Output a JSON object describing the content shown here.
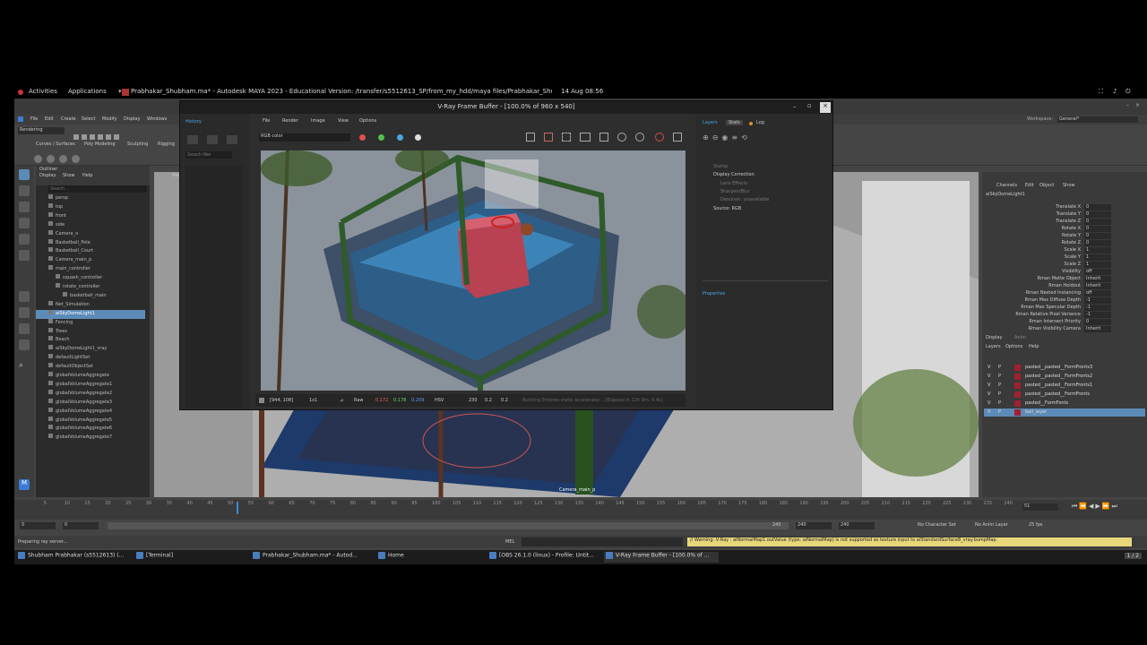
{
  "topbar": {
    "activities": "Activities",
    "applications": "Applications",
    "window_title": "Prabhakar_Shubham.ma* - Autodesk MAYA 2023 - Educational Version: /transfer/s5512613_SP/from_my_hdd/maya files/Prabhakar_Shu...",
    "clock": "14 Aug 08:56"
  },
  "maya": {
    "menu": [
      "File",
      "Edit",
      "Create",
      "Select",
      "Modify",
      "Display",
      "Windows"
    ],
    "mode": "Rendering",
    "shelf_tabs": [
      "Curves / Surfaces",
      "Poly Modeling",
      "Sculpting",
      "Rigging"
    ],
    "workspace_label": "Workspace:",
    "workspace_value": "General*",
    "outliner": {
      "title": "Outliner",
      "menu": [
        "Display",
        "Show",
        "Help"
      ],
      "search_placeholder": "Search...",
      "items": [
        {
          "label": "persp",
          "selected": false,
          "indent": 1
        },
        {
          "label": "top",
          "selected": false,
          "indent": 1
        },
        {
          "label": "front",
          "selected": false,
          "indent": 1
        },
        {
          "label": "side",
          "selected": false,
          "indent": 1
        },
        {
          "label": "Camera_o",
          "selected": false,
          "indent": 1
        },
        {
          "label": "Basketball_Pole",
          "selected": false,
          "indent": 1
        },
        {
          "label": "Basketball_Court",
          "selected": false,
          "indent": 1
        },
        {
          "label": "Camera_main_p",
          "selected": false,
          "indent": 1
        },
        {
          "label": "main_controller",
          "selected": false,
          "indent": 1
        },
        {
          "label": "squash_controller",
          "selected": false,
          "indent": 2
        },
        {
          "label": "rotate_controller",
          "selected": false,
          "indent": 2
        },
        {
          "label": "basketball_main",
          "selected": false,
          "indent": 3
        },
        {
          "label": "Net_Simulation",
          "selected": false,
          "indent": 1
        },
        {
          "label": "aiSkyDomeLight1",
          "selected": true,
          "indent": 1
        },
        {
          "label": "Fencing",
          "selected": false,
          "indent": 1
        },
        {
          "label": "Trees",
          "selected": false,
          "indent": 1
        },
        {
          "label": "Beach",
          "selected": false,
          "indent": 1
        },
        {
          "label": "aiSkyDomeLight1_vray",
          "selected": false,
          "indent": 1
        },
        {
          "label": "defaultLightSet",
          "selected": false,
          "indent": 1
        },
        {
          "label": "defaultObjectSet",
          "selected": false,
          "indent": 1
        },
        {
          "label": "globalVolumeAggregate",
          "selected": false,
          "indent": 1
        },
        {
          "label": "globalVolumeAggregate1",
          "selected": false,
          "indent": 1
        },
        {
          "label": "globalVolumeAggregate2",
          "selected": false,
          "indent": 1
        },
        {
          "label": "globalVolumeAggregate3",
          "selected": false,
          "indent": 1
        },
        {
          "label": "globalVolumeAggregate4",
          "selected": false,
          "indent": 1
        },
        {
          "label": "globalVolumeAggregate5",
          "selected": false,
          "indent": 1
        },
        {
          "label": "globalVolumeAggregate6",
          "selected": false,
          "indent": 1
        },
        {
          "label": "globalVolumeAggregate7",
          "selected": false,
          "indent": 1
        }
      ]
    },
    "viewport_menu": [
      "View"
    ],
    "camera_label": "Camera_main_p",
    "channel_box": {
      "menu": [
        "Channels",
        "Edit",
        "Object",
        "Show"
      ],
      "node": "aiSkyDomeLight1",
      "attrs": [
        {
          "name": "Translate X",
          "value": "0"
        },
        {
          "name": "Translate Y",
          "value": "0"
        },
        {
          "name": "Translate Z",
          "value": "0"
        },
        {
          "name": "Rotate X",
          "value": "0"
        },
        {
          "name": "Rotate Y",
          "value": "0"
        },
        {
          "name": "Rotate Z",
          "value": "0"
        },
        {
          "name": "Scale X",
          "value": "1"
        },
        {
          "name": "Scale Y",
          "value": "1"
        },
        {
          "name": "Scale Z",
          "value": "1"
        },
        {
          "name": "Visibility",
          "value": "off"
        },
        {
          "name": "Rman Matte Object",
          "value": "Inherit"
        },
        {
          "name": "Rman Holdout",
          "value": "Inherit"
        },
        {
          "name": "Rman Nested Instancing",
          "value": "off"
        },
        {
          "name": "Rman Max Diffuse Depth",
          "value": "-1"
        },
        {
          "name": "Rman Max Specular Depth",
          "value": "-1"
        },
        {
          "name": "Rman Relative Pixel Variance",
          "value": "-1"
        },
        {
          "name": "Rman Intersect Priority",
          "value": "0"
        },
        {
          "name": "Rman Visibility Camera",
          "value": "Inherit"
        }
      ],
      "tabs": [
        "Display",
        "Anim"
      ],
      "layer_menu": [
        "Layers",
        "Options",
        "Help"
      ],
      "layers": [
        {
          "v": "V",
          "p": "P",
          "name": "pasted__pasted__FormFronts3",
          "selected": false
        },
        {
          "v": "V",
          "p": "P",
          "name": "pasted__pasted__FormFronts2",
          "selected": false
        },
        {
          "v": "V",
          "p": "P",
          "name": "pasted__pasted__FormFronts1",
          "selected": false
        },
        {
          "v": "V",
          "p": "P",
          "name": "pasted__pasted__FormFronts",
          "selected": false
        },
        {
          "v": "V",
          "p": "P",
          "name": "pasted__FormFonts",
          "selected": false
        },
        {
          "v": "V",
          "p": "P",
          "name": "ball_layer",
          "selected": true
        }
      ]
    },
    "timeline": {
      "ticks": [
        "5",
        "10",
        "15",
        "20",
        "25",
        "30",
        "35",
        "40",
        "45",
        "50",
        "55",
        "60",
        "65",
        "70",
        "75",
        "80",
        "85",
        "90",
        "95",
        "100",
        "105",
        "110",
        "115",
        "120",
        "125",
        "130",
        "135",
        "140",
        "145",
        "150",
        "155",
        "160",
        "165",
        "170",
        "175",
        "180",
        "185",
        "190",
        "195",
        "200",
        "205",
        "210",
        "215",
        "220",
        "225",
        "230",
        "235",
        "240"
      ],
      "current_frame": "51"
    },
    "range": {
      "start": "0",
      "start2": "0",
      "end1": "240",
      "end2": "240",
      "end3": "240",
      "char_set": "No Character Set",
      "anim_layer": "No Anim Layer",
      "fps": "25 fps"
    },
    "mel_label": "MEL",
    "status": "Preparing ray server...",
    "warning": "// Warning: V-Ray : aiNormalMap1.outValue (type: aiNormalMap) is not supported as texture input to aiStandardSurface8_vray.bumpMap."
  },
  "vfb": {
    "title": "V-Ray Frame Buffer - [100.0% of 960 x 540]",
    "history_tab": "History",
    "history_search": "Search filter",
    "menu": [
      "File",
      "Render",
      "Image",
      "View",
      "Options"
    ],
    "channel": "RGB color",
    "status": {
      "coords": "[944, 108]",
      "zoom": "1x1",
      "raw": "Raw",
      "r": "0.172",
      "g": "0.178",
      "b": "0.209",
      "mode": "HSV",
      "h": "230",
      "s": "0.2",
      "v": "0.2",
      "info": "Building Embree static accelerator... [Elapsed in 12h 9m: 9.4s]"
    },
    "side_tabs": [
      "Layers",
      "Stats",
      "Log"
    ],
    "layers": [
      "Stamp",
      "Display Correction",
      "Lens Effects",
      "Sharpen/Blur",
      "Denoiser: unavailable",
      "Source: RGB"
    ],
    "properties": "Properties",
    "dots": [
      "#e05050",
      "#50c050",
      "#4aa8e0"
    ]
  },
  "taskbar": {
    "items": [
      {
        "label": "Shubham Prabhakar (s5512613) (...",
        "active": false
      },
      {
        "label": "[Terminal]",
        "active": false
      },
      {
        "label": "Prabhakar_Shubham.ma* - Autod...",
        "active": false
      },
      {
        "label": "Home",
        "active": false
      },
      {
        "label": "[OBS 26.1.0 (linux) - Profile: Untit...",
        "active": false
      },
      {
        "label": "V-Ray Frame Buffer - [100.0% of ...",
        "active": true
      }
    ],
    "workspace": "1 / 2"
  }
}
